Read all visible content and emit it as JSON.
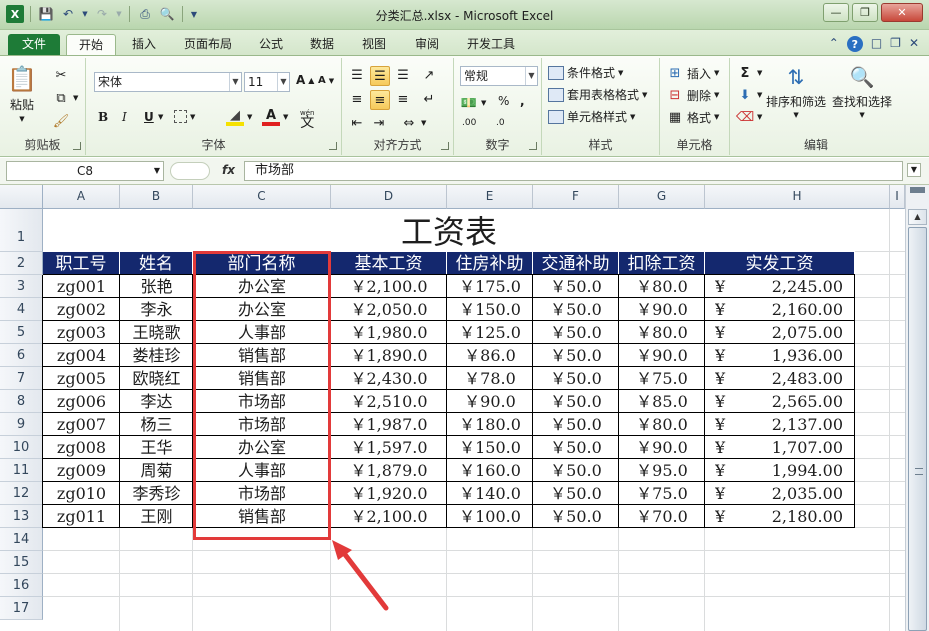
{
  "window": {
    "title": "分类汇总.xlsx - Microsoft Excel"
  },
  "tabs": [
    {
      "label": "文件",
      "kind": "file"
    },
    {
      "label": "开始",
      "kind": "active"
    },
    {
      "label": "插入"
    },
    {
      "label": "页面布局"
    },
    {
      "label": "公式"
    },
    {
      "label": "数据"
    },
    {
      "label": "视图"
    },
    {
      "label": "审阅"
    },
    {
      "label": "开发工具"
    }
  ],
  "ribbon": {
    "clipboard": {
      "paste": "粘贴",
      "label": "剪贴板"
    },
    "font": {
      "name": "宋体",
      "size": "11",
      "label": "字体",
      "bold": "B",
      "italic": "I",
      "underline": "U",
      "wen": "wén"
    },
    "align": {
      "label": "对齐方式"
    },
    "number": {
      "format": "常规",
      "label": "数字",
      "percent": "%",
      "comma": ",",
      "dec_inc": ".00",
      "dec_dec": ".0"
    },
    "styles": {
      "cond": "条件格式",
      "table": "套用表格格式",
      "cell": "单元格样式",
      "label": "样式"
    },
    "cells": {
      "insert": "插入",
      "delete": "删除",
      "format": "格式",
      "label": "单元格"
    },
    "editing": {
      "sort": "排序和筛选",
      "find": "查找和选择",
      "label": "编辑"
    }
  },
  "formula_bar": {
    "name_box": "C8",
    "fx": "fx",
    "value": "市场部"
  },
  "columns": [
    "A",
    "B",
    "C",
    "D",
    "E",
    "F",
    "G",
    "H",
    "I"
  ],
  "rows": [
    "1",
    "2",
    "3",
    "4",
    "5",
    "6",
    "7",
    "8",
    "9",
    "10",
    "11",
    "12",
    "13",
    "14",
    "15",
    "16",
    "17"
  ],
  "sheet": {
    "title": "工资表",
    "headers": [
      "职工号",
      "姓名",
      "部门名称",
      "基本工资",
      "住房补助",
      "交通补助",
      "扣除工资",
      "实发工资"
    ],
    "data": [
      [
        "zg001",
        "张艳",
        "办公室",
        "￥2,100.0",
        "￥175.0",
        "￥50.0",
        "￥80.0",
        "2,245.00"
      ],
      [
        "zg002",
        "李永",
        "办公室",
        "￥2,050.0",
        "￥150.0",
        "￥50.0",
        "￥90.0",
        "2,160.00"
      ],
      [
        "zg003",
        "王晓歌",
        "人事部",
        "￥1,980.0",
        "￥125.0",
        "￥50.0",
        "￥80.0",
        "2,075.00"
      ],
      [
        "zg004",
        "娄桂珍",
        "销售部",
        "￥1,890.0",
        "￥86.0",
        "￥50.0",
        "￥90.0",
        "1,936.00"
      ],
      [
        "zg005",
        "欧晓红",
        "销售部",
        "￥2,430.0",
        "￥78.0",
        "￥50.0",
        "￥75.0",
        "2,483.00"
      ],
      [
        "zg006",
        "李达",
        "市场部",
        "￥2,510.0",
        "￥90.0",
        "￥50.0",
        "￥85.0",
        "2,565.00"
      ],
      [
        "zg007",
        "杨三",
        "市场部",
        "￥1,987.0",
        "￥180.0",
        "￥50.0",
        "￥80.0",
        "2,137.00"
      ],
      [
        "zg008",
        "王华",
        "办公室",
        "￥1,597.0",
        "￥150.0",
        "￥50.0",
        "￥90.0",
        "1,707.00"
      ],
      [
        "zg009",
        "周菊",
        "人事部",
        "￥1,879.0",
        "￥160.0",
        "￥50.0",
        "￥95.0",
        "1,994.00"
      ],
      [
        "zg010",
        "李秀珍",
        "市场部",
        "￥1,920.0",
        "￥140.0",
        "￥50.0",
        "￥75.0",
        "2,035.00"
      ],
      [
        "zg011",
        "王刚",
        "销售部",
        "￥2,100.0",
        "￥100.0",
        "￥50.0",
        "￥70.0",
        "2,180.00"
      ]
    ],
    "currency_symbol": "¥"
  },
  "colors": {
    "header_bg": "#14286e",
    "highlight": "#e23a3a",
    "file_tab": "#1e7b37"
  }
}
